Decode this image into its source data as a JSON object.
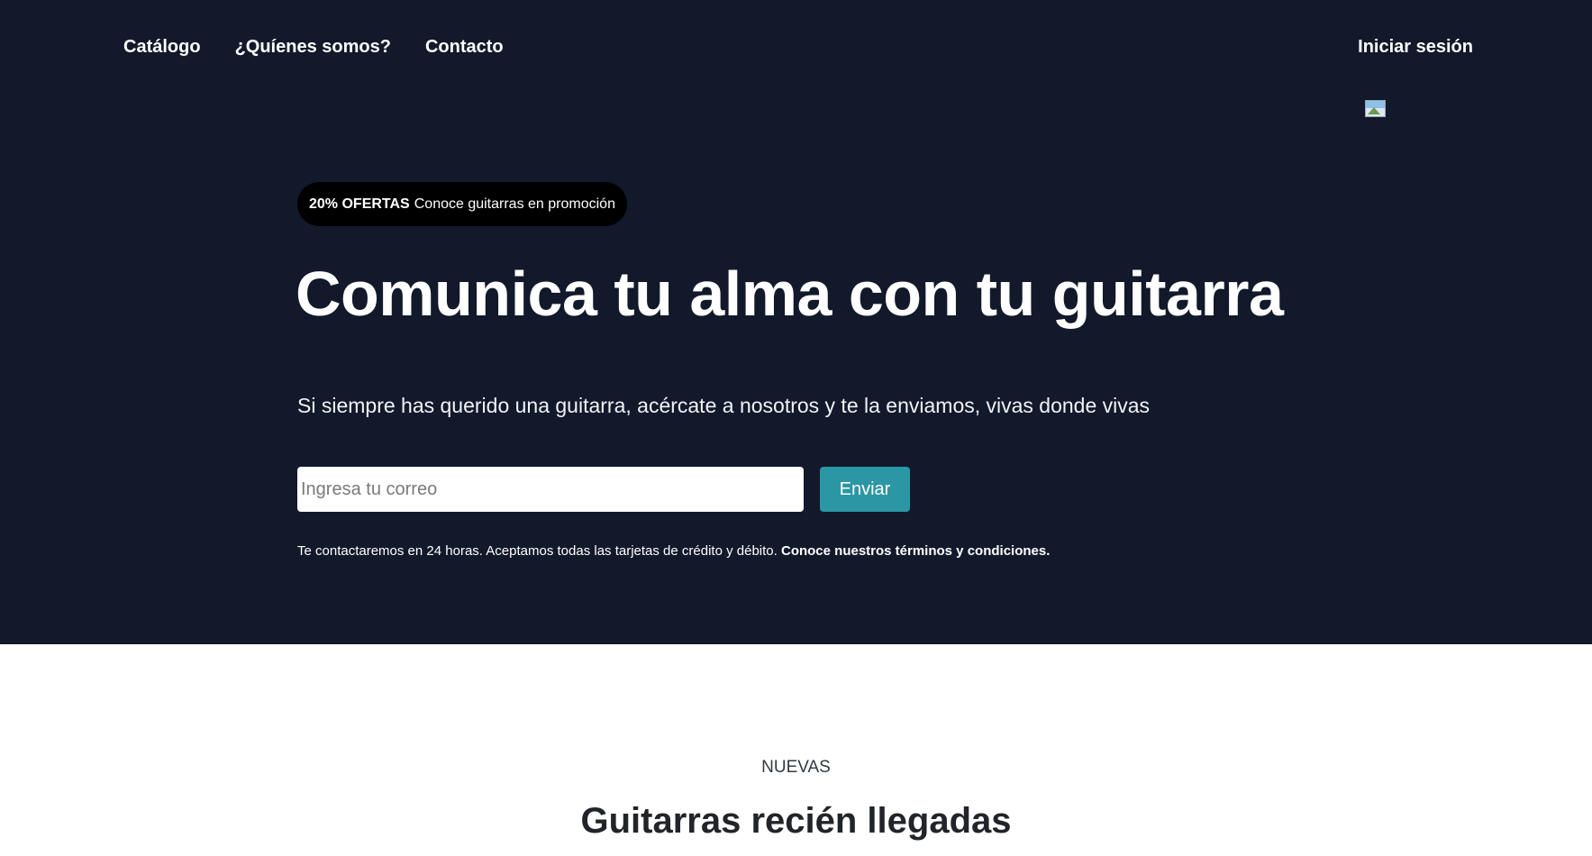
{
  "nav": {
    "items": [
      {
        "label": "Catálogo"
      },
      {
        "label": "¿Quíenes somos?"
      },
      {
        "label": "Contacto"
      }
    ],
    "login_label": "Iniciar sesión"
  },
  "hero": {
    "promo_strong": "20% OFERTAS",
    "promo_text": "Conoce guitarras en promoción",
    "title": "Comunica tu alma con tu guitarra",
    "subtitle": "Si siempre has querido una guitarra, acércate a nosotros y te la enviamos, vivas donde vivas",
    "email_placeholder": "Ingresa tu correo",
    "email_value": "",
    "send_label": "Enviar",
    "fine_print": "Te contactaremos en 24 horas. Aceptamos todas las tarjetas de crédito y débito.",
    "terms_link": "Conoce nuestros términos y condiciones.",
    "background_color": "#12192b",
    "accent_color": "#2b96a4"
  },
  "new_section": {
    "eyebrow": "NUEVAS",
    "title": "Guitarras recién llegadas"
  },
  "icons": {
    "broken_image": "broken-image-icon"
  }
}
